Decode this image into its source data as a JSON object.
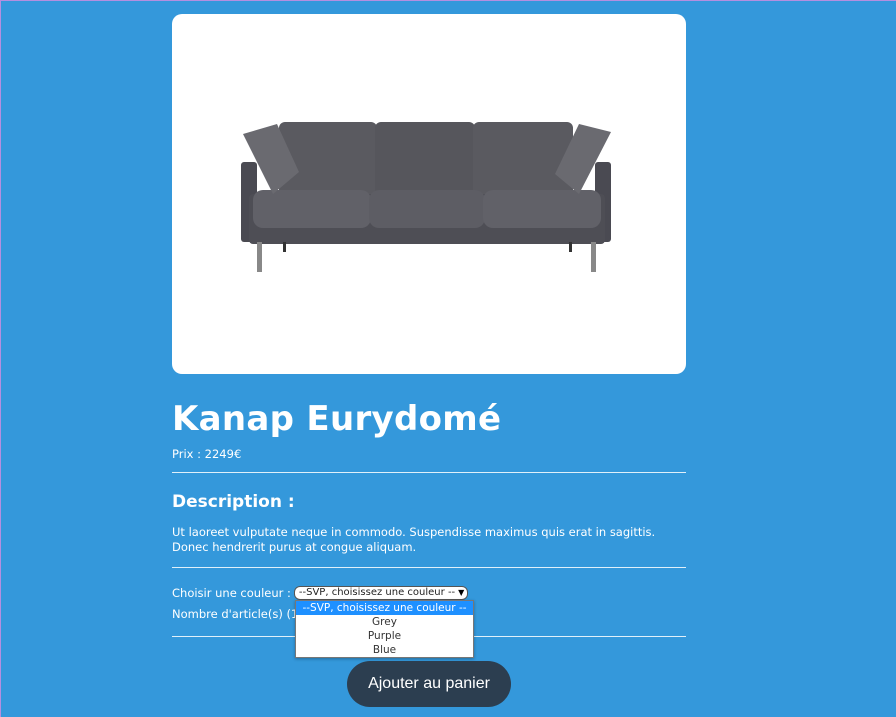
{
  "product": {
    "name": "Kanap Eurydomé",
    "price_label": "Prix : ",
    "price_value": "2249",
    "currency": "€",
    "description_title": "Description :",
    "description": "Ut laoreet vulputate neque in commodo. Suspendisse maximus quis erat in sagittis. Donec hendrerit purus at congue aliquam.",
    "image_icon": "sofa-image"
  },
  "options": {
    "color_label": "Choisir une couleur :",
    "color_selected": "--SVP, choisissez une couleur --",
    "color_options": [
      "--SVP, choisissez une couleur --",
      "Grey",
      "Purple",
      "Blue"
    ],
    "quantity_label": "Nombre d'article(s) (1"
  },
  "actions": {
    "add_to_cart": "Ajouter au panier"
  },
  "colors": {
    "background": "#3498db",
    "button": "#2c3e50",
    "selected_option": "#1e90ff"
  }
}
